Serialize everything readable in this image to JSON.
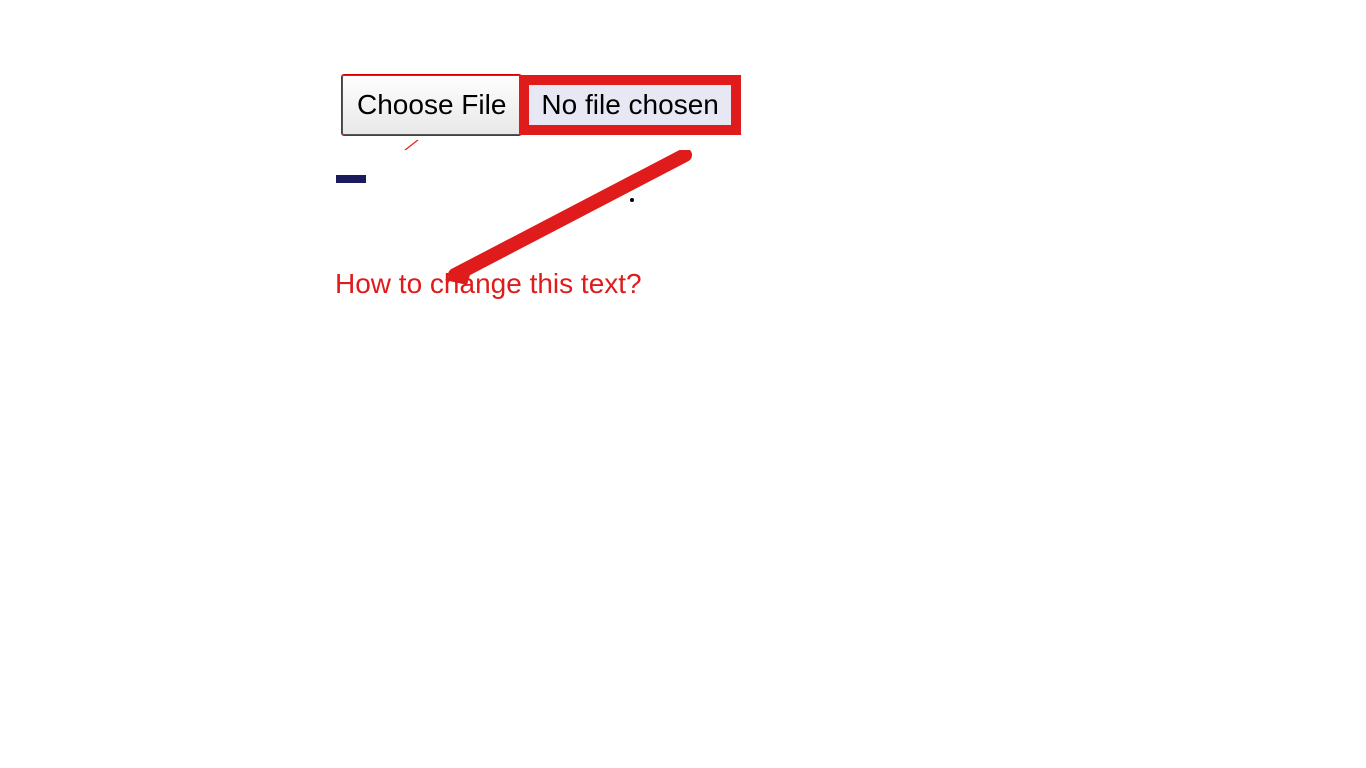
{
  "file_input": {
    "button_label": "Choose File",
    "status_text": "No file chosen"
  },
  "annotation": {
    "question_text": "How to change this text?"
  },
  "colors": {
    "highlight_red": "#e01b1b",
    "background_lavender": "#e8e8f5"
  }
}
